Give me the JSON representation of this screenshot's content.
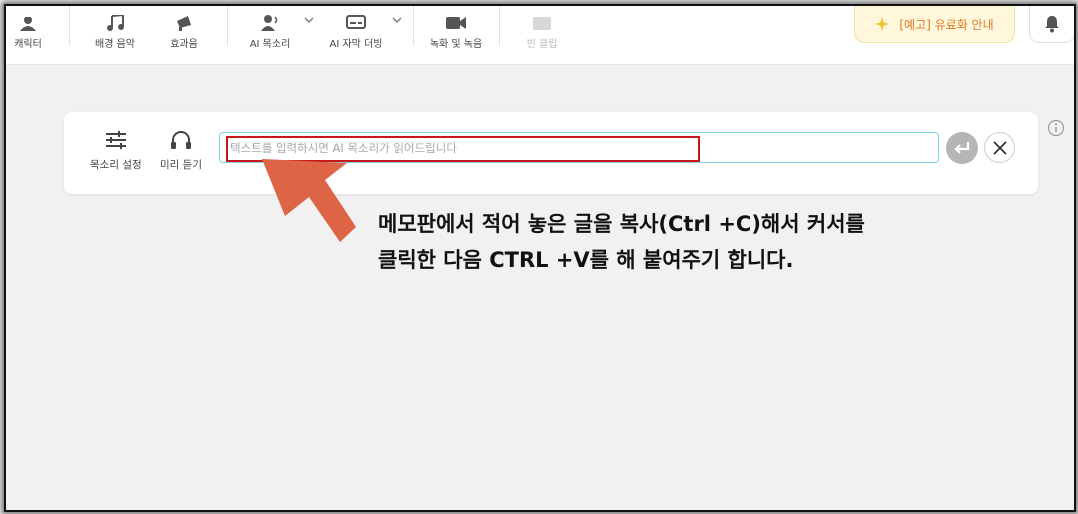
{
  "toolbar": {
    "items": [
      {
        "label": "캐릭터",
        "icon": "character-icon"
      },
      {
        "label": "배경 음악",
        "icon": "music-note-icon"
      },
      {
        "label": "효과음",
        "icon": "sound-effect-icon"
      },
      {
        "label": "AI 목소리",
        "icon": "ai-voice-icon"
      },
      {
        "label": "AI 자막 더빙",
        "icon": "ai-subtitle-icon"
      },
      {
        "label": "녹화 및 녹음",
        "icon": "video-camera-icon"
      },
      {
        "label": "빈 클립",
        "icon": "blank-clip-icon"
      }
    ],
    "promo_label": "[예고] 유료화 안내"
  },
  "panel": {
    "voice_settings_label": "목소리 설정",
    "preview_label": "미리 듣기",
    "input_placeholder": "텍스트를 입력하시면 AI 목소리가 읽어드립니다",
    "input_value": ""
  },
  "annotation": {
    "line1": "메모판에서 적어 놓은 글을 복사(Ctrl +C)해서 커서를",
    "line2": "클릭한 다음 CTRL +V를 해 붙여주기 합니다."
  },
  "colors": {
    "arrow": "#dd6445",
    "highlight_border": "#c8161b",
    "input_border": "#7fd0e6",
    "promo_text": "#e07a26",
    "promo_background": "#fff7dc"
  }
}
